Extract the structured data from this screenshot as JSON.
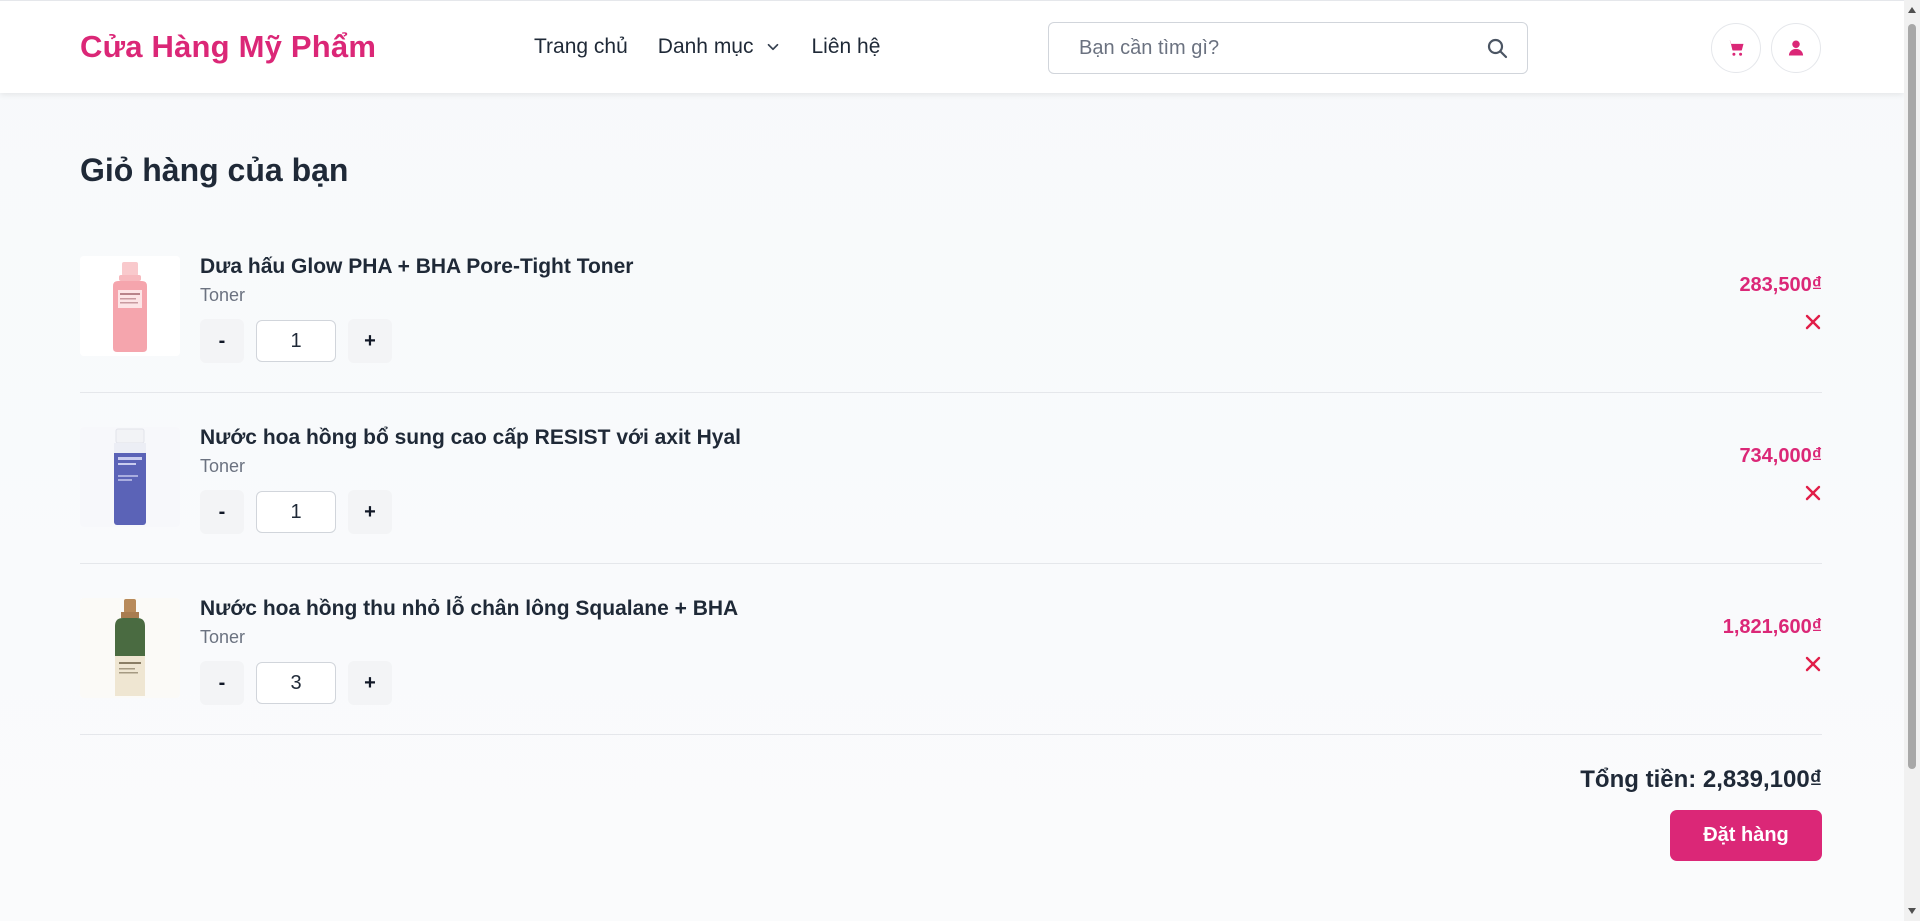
{
  "header": {
    "brand": "Cửa Hàng Mỹ Phẩm",
    "nav": [
      {
        "label": "Trang chủ"
      },
      {
        "label": "Danh mục"
      },
      {
        "label": "Liên hệ"
      }
    ],
    "search_placeholder": "Bạn cần tìm gì?",
    "brand_color": "#db2777"
  },
  "cart": {
    "title": "Giỏ hàng của bạn",
    "items": [
      {
        "name": "Dưa hấu Glow PHA + BHA Pore-Tight Toner",
        "category": "Toner",
        "quantity": "1",
        "price": "283,500₫",
        "image": "pink-toner-bottle"
      },
      {
        "name": "Nước hoa hồng bổ sung cao cấp RESIST với axit Hyal",
        "category": "Toner",
        "quantity": "1",
        "price": "734,000₫",
        "image": "blue-toner-bottle"
      },
      {
        "name": "Nước hoa hồng thu nhỏ lỗ chân lông Squalane + BHA",
        "category": "Toner",
        "quantity": "3",
        "price": "1,821,600₫",
        "image": "green-toner-bottle"
      }
    ],
    "minus_label": "-",
    "plus_label": "+",
    "total": "Tổng tiền: 2,839,100₫",
    "order_label": "Đặt hàng"
  }
}
